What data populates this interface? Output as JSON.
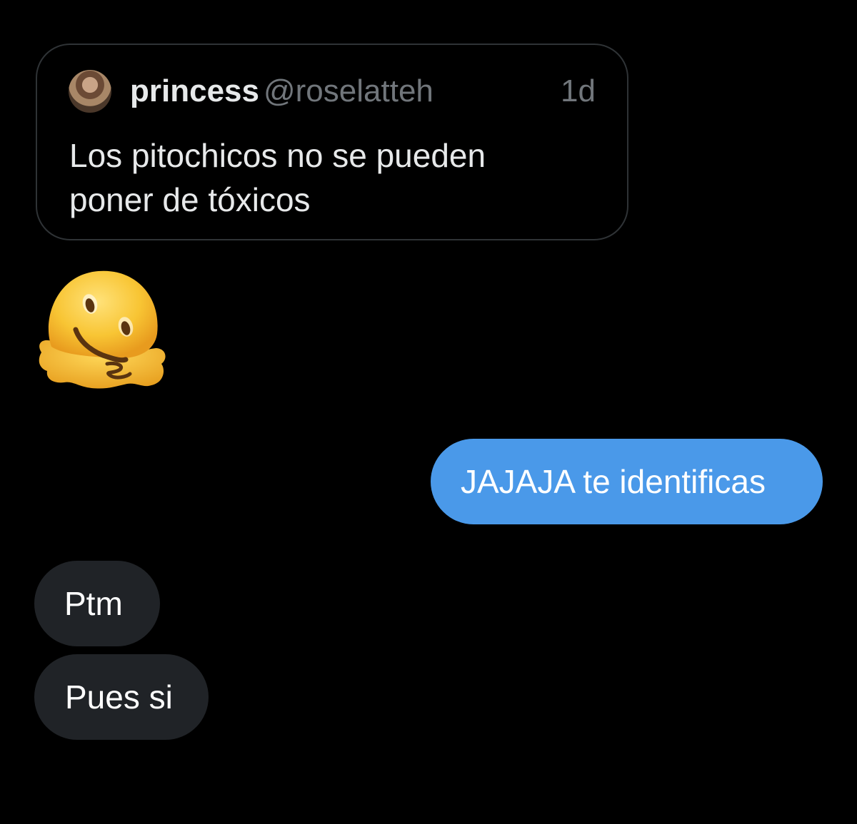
{
  "quoted_tweet": {
    "display_name": "princess",
    "handle": "@roselatteh",
    "timestamp": "1d",
    "text_line_1": "Los pitochicos no se pueden",
    "text_line_2": "poner de tóxicos"
  },
  "messages": {
    "emoji_reaction": "melting-face-emoji",
    "sent_1": "JAJAJA te identificas",
    "received_1": "Ptm",
    "received_2": "Pues si"
  },
  "colors": {
    "background": "#000000",
    "sent_bubble": "#4a99e9",
    "received_bubble": "#202327",
    "secondary_text": "#71767b"
  }
}
